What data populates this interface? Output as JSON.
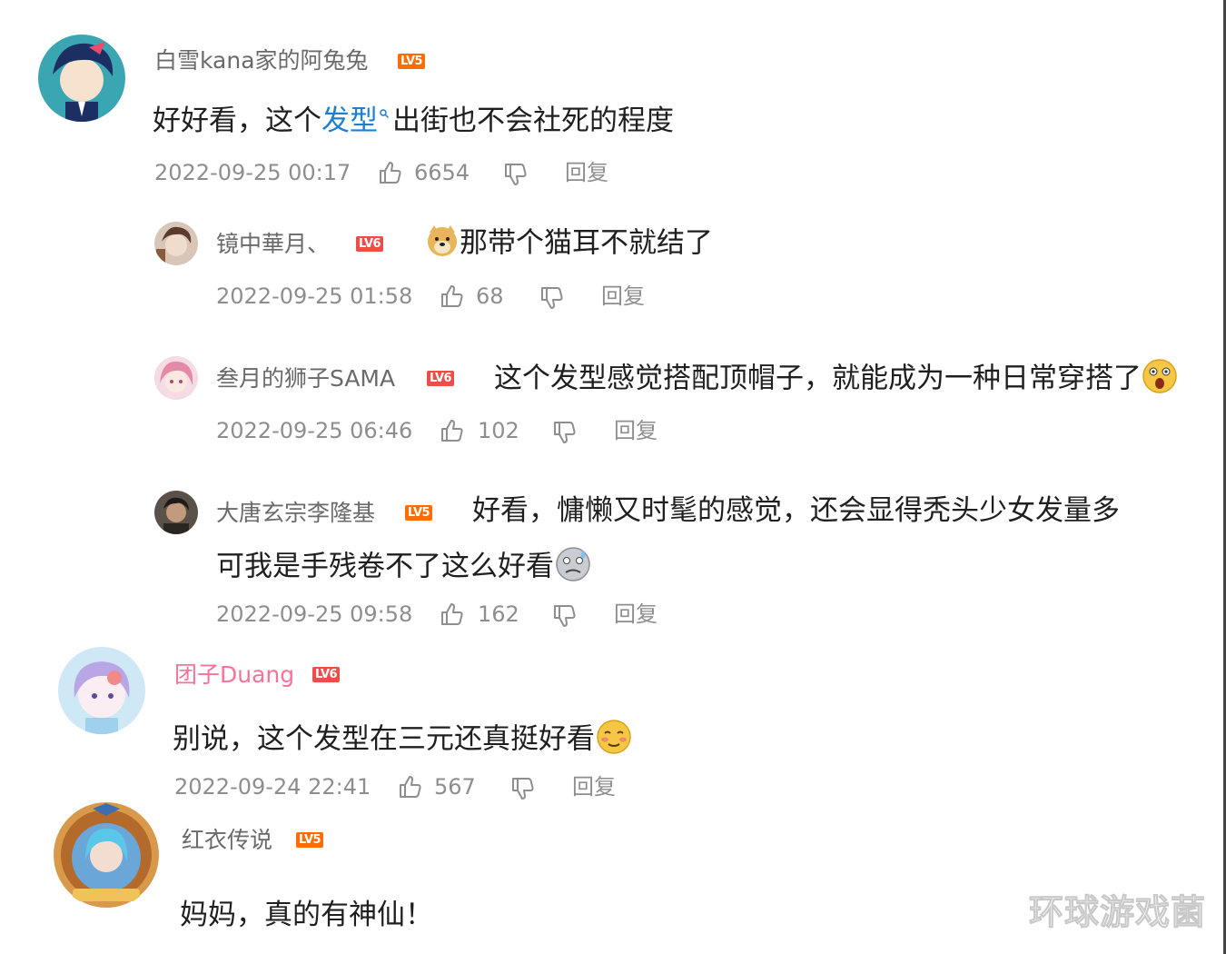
{
  "comments": [
    {
      "username": "白雪kana家的阿兔兔",
      "level": "LV5",
      "text_before": "好好看，这个",
      "link_text": "发型",
      "text_after": "出街也不会社死的程度",
      "timestamp": "2022-09-25 00:17",
      "likes": "6654",
      "reply_label": "回复"
    },
    {
      "username": "镜中華月、",
      "level": "LV6",
      "emoji": "doge",
      "text": "那带个猫耳不就结了",
      "timestamp": "2022-09-25 01:58",
      "likes": "68",
      "reply_label": "回复"
    },
    {
      "username": "叁月的狮子SAMA",
      "level": "LV6",
      "text": "这个发型感觉搭配顶帽子，就能成为一种日常穿搭了",
      "emoji": "surprised",
      "timestamp": "2022-09-25 06:46",
      "likes": "102",
      "reply_label": "回复"
    },
    {
      "username": "大唐玄宗李隆基",
      "level": "LV5",
      "text_line1": "好看，慵懒又时髦的感觉，还会显得秃头少女发量多",
      "text_line2": "可我是手残卷不了这么好看",
      "emoji": "sweat",
      "timestamp": "2022-09-25 09:58",
      "likes": "162",
      "reply_label": "回复"
    },
    {
      "username": "团子Duang",
      "level": "LV6",
      "text": "别说，这个发型在三元还真挺好看",
      "emoji": "shy",
      "timestamp": "2022-09-24 22:41",
      "likes": "567",
      "reply_label": "回复"
    },
    {
      "username": "红衣传说",
      "level": "LV5",
      "text": "妈妈，真的有神仙！"
    }
  ],
  "watermark": "环球游戏菌",
  "colors": {
    "link": "#1e7fd0",
    "username": "#6a6a6a",
    "vip_username": "#fb7299",
    "level_badge": "#ff6c00",
    "meta": "#8e8e8e"
  }
}
